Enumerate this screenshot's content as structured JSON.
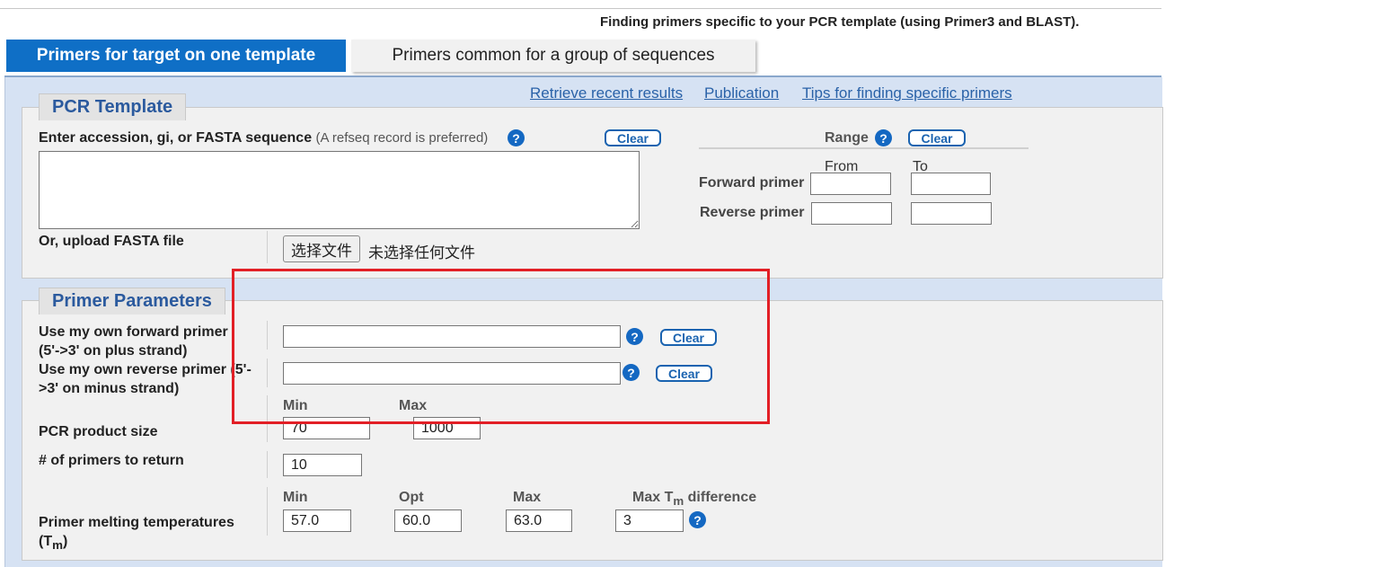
{
  "header": {
    "tagline": "Finding primers specific to your PCR template (using Primer3 and BLAST)."
  },
  "tabs": [
    {
      "label": "Primers for target on one template",
      "active": true
    },
    {
      "label": "Primers common for a group of sequences",
      "active": false
    }
  ],
  "links": {
    "retrieve": "Retrieve recent results",
    "publication": "Publication",
    "tips": "Tips for finding specific primers"
  },
  "template": {
    "legend": "PCR Template",
    "accession_label": "Enter accession, gi, or FASTA sequence",
    "accession_note": "(A refseq record is preferred)",
    "clear": "Clear",
    "upload_label": "Or, upload FASTA file",
    "file_button": "选择文件",
    "file_status": "未选择任何文件",
    "range": {
      "title": "Range",
      "clear": "Clear",
      "from": "From",
      "to": "To",
      "forward": "Forward primer",
      "reverse": "Reverse primer"
    }
  },
  "params": {
    "legend": "Primer Parameters",
    "fwd_label": "Use my own forward primer (5'->3' on plus strand)",
    "rev_label": "Use my own reverse primer (5'->3' on minus strand)",
    "fwd_clear": "Clear",
    "rev_clear": "Clear",
    "product": {
      "label": "PCR product size",
      "min_hdr": "Min",
      "max_hdr": "Max",
      "min": "70",
      "max": "1000"
    },
    "num": {
      "label": "# of primers to return",
      "value": "10"
    },
    "tm": {
      "label": "Primer melting temperatures (T",
      "label_sub": "m",
      "label_end": ")",
      "min_hdr": "Min",
      "opt_hdr": "Opt",
      "max_hdr": "Max",
      "diff_hdr": "Max T",
      "diff_sub": "m",
      "diff_end": " difference",
      "min": "57.0",
      "opt": "60.0",
      "max": "63.0",
      "diff": "3"
    }
  },
  "help_icon": "question-circle-icon",
  "colors": {
    "accent": "#0f6fc6",
    "panel": "#d6e2f3",
    "highlight": "#e21f26",
    "link": "#2a62a8"
  }
}
